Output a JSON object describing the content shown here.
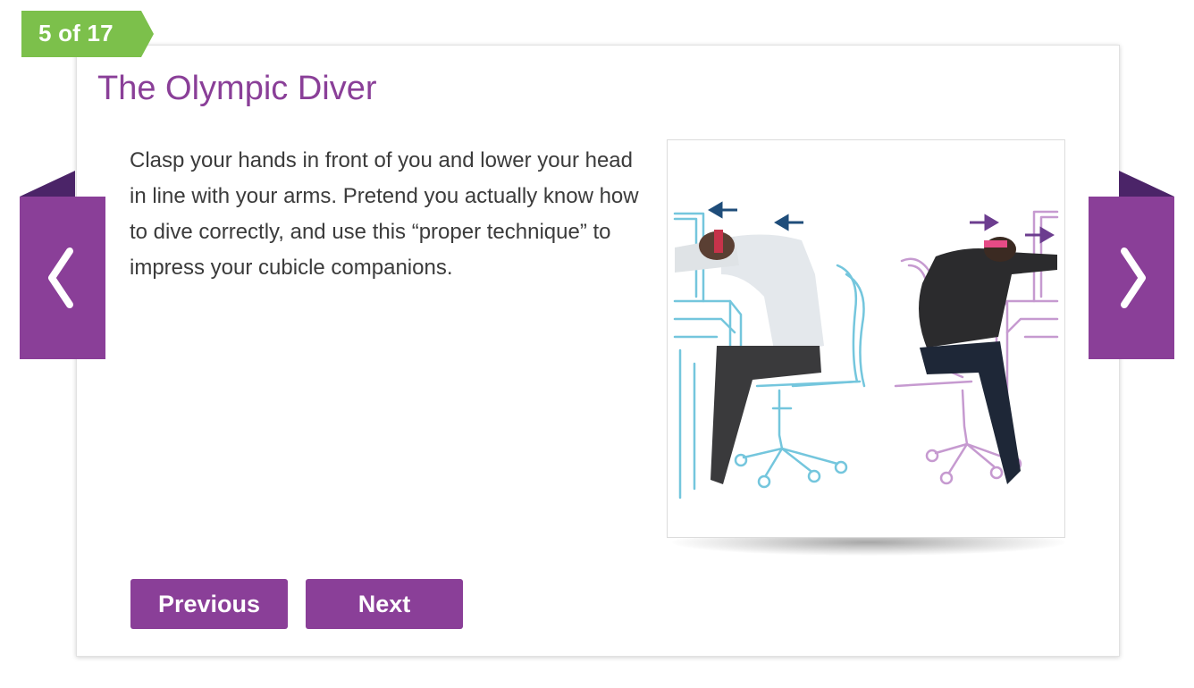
{
  "slideshow": {
    "counter": "5 of 17",
    "title": "The Olympic Diver",
    "description": "Clasp your hands in front of you and lower your head in line with your arms. Pretend you actually know how to dive correctly, and use this “proper technique” to impress your cubicle companions.",
    "prev_label": "Previous",
    "next_label": "Next",
    "image": "illustration-two-people-stretching-at-desks",
    "icons": {
      "prev_arrow": "chevron-left-icon",
      "next_arrow": "chevron-right-icon"
    }
  },
  "colors": {
    "accent_purple": "#8a3f98",
    "dark_purple": "#4b2468",
    "ribbon_green": "#7cc04b",
    "line_blue": "#74c6dd",
    "line_pink": "#c69ad0",
    "arrow_navy": "#1f4d7a"
  }
}
